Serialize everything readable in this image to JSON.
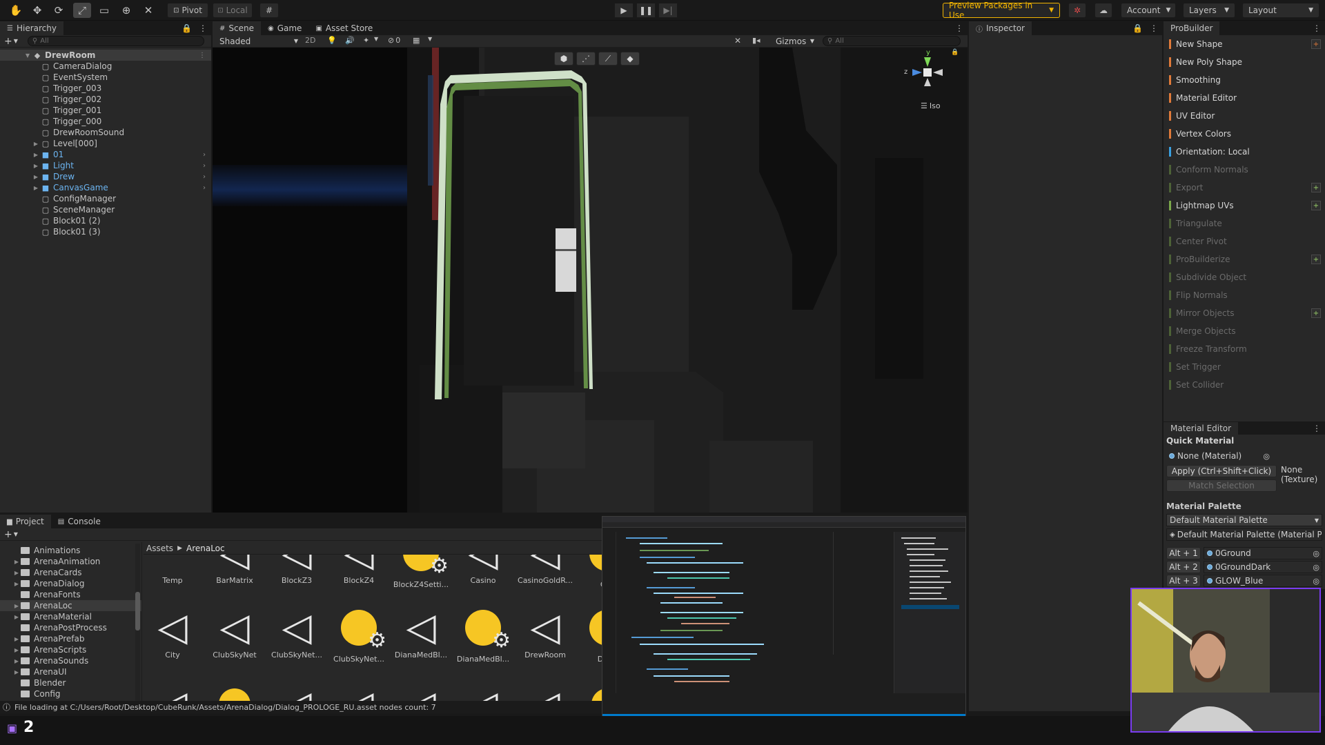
{
  "toolbar": {
    "pivot_label": "Pivot",
    "local_label": "Local",
    "preview_label": "Preview Packages in Use",
    "account_label": "Account",
    "layers_label": "Layers",
    "layout_label": "Layout"
  },
  "hierarchy": {
    "tab_label": "Hierarchy",
    "search_placeholder": "All",
    "root": "DrewRoom",
    "items": [
      {
        "label": "CameraDialog",
        "prefab": false,
        "expand": false
      },
      {
        "label": "EventSystem",
        "prefab": false,
        "expand": false
      },
      {
        "label": "Trigger_003",
        "prefab": false,
        "expand": false
      },
      {
        "label": "Trigger_002",
        "prefab": false,
        "expand": false
      },
      {
        "label": "Trigger_001",
        "prefab": false,
        "expand": false
      },
      {
        "label": "Trigger_000",
        "prefab": false,
        "expand": false
      },
      {
        "label": "DrewRoomSound",
        "prefab": false,
        "expand": false
      },
      {
        "label": "Level[000]",
        "prefab": false,
        "expand": true
      },
      {
        "label": "01",
        "prefab": true,
        "expand": true
      },
      {
        "label": "Light",
        "prefab": true,
        "expand": true
      },
      {
        "label": "Drew",
        "prefab": true,
        "expand": true
      },
      {
        "label": "CanvasGame",
        "prefab": true,
        "expand": true
      },
      {
        "label": "ConfigManager",
        "prefab": false,
        "expand": false
      },
      {
        "label": "SceneManager",
        "prefab": false,
        "expand": false
      },
      {
        "label": "Block01 (2)",
        "prefab": false,
        "expand": false
      },
      {
        "label": "Block01 (3)",
        "prefab": false,
        "expand": false
      }
    ]
  },
  "scene": {
    "tabs": {
      "scene": "Scene",
      "game": "Game",
      "asset_store": "Asset Store"
    },
    "shading": "Shaded",
    "mode_2d": "2D",
    "hidden_count": "0",
    "gizmos": "Gizmos",
    "search_placeholder": "All",
    "iso_label": "Iso",
    "axis_y": "y",
    "axis_z": "z"
  },
  "inspector": {
    "tab_label": "Inspector"
  },
  "probuilder": {
    "tab_label": "ProBuilder",
    "items": [
      {
        "label": "New Shape",
        "enabled": true,
        "color": "#e07a3a",
        "plus": true
      },
      {
        "label": "New Poly Shape",
        "enabled": true,
        "color": "#e07a3a",
        "plus": false
      },
      {
        "label": "Smoothing",
        "enabled": true,
        "color": "#e07a3a",
        "plus": false
      },
      {
        "label": "Material Editor",
        "enabled": true,
        "color": "#e07a3a",
        "plus": false
      },
      {
        "label": "UV Editor",
        "enabled": true,
        "color": "#e07a3a",
        "plus": false
      },
      {
        "label": "Vertex Colors",
        "enabled": true,
        "color": "#e07a3a",
        "plus": false
      },
      {
        "label": "Orientation: Local",
        "enabled": true,
        "color": "#3aa0e0",
        "plus": false
      },
      {
        "label": "Conform Normals",
        "enabled": false,
        "color": "#7aa84a",
        "plus": false
      },
      {
        "label": "Export",
        "enabled": false,
        "color": "#7aa84a",
        "plus": true
      },
      {
        "label": "Lightmap UVs",
        "enabled": true,
        "color": "#7aa84a",
        "plus": true
      },
      {
        "label": "Triangulate",
        "enabled": false,
        "color": "#7aa84a",
        "plus": false
      },
      {
        "label": "Center Pivot",
        "enabled": false,
        "color": "#7aa84a",
        "plus": false
      },
      {
        "label": "ProBuilderize",
        "enabled": false,
        "color": "#7aa84a",
        "plus": true
      },
      {
        "label": "Subdivide Object",
        "enabled": false,
        "color": "#7aa84a",
        "plus": false
      },
      {
        "label": "Flip Normals",
        "enabled": false,
        "color": "#7aa84a",
        "plus": false
      },
      {
        "label": "Mirror Objects",
        "enabled": false,
        "color": "#7aa84a",
        "plus": true
      },
      {
        "label": "Merge Objects",
        "enabled": false,
        "color": "#7aa84a",
        "plus": false
      },
      {
        "label": "Freeze Transform",
        "enabled": false,
        "color": "#7aa84a",
        "plus": false
      },
      {
        "label": "Set Trigger",
        "enabled": false,
        "color": "#7aa84a",
        "plus": false
      },
      {
        "label": "Set Collider",
        "enabled": false,
        "color": "#7aa84a",
        "plus": false
      }
    ]
  },
  "material_editor": {
    "tab_label": "Material Editor",
    "quick_material": "Quick Material",
    "none_material": "None (Material)",
    "apply_label": "Apply (Ctrl+Shift+Click)",
    "match_label": "Match Selection",
    "texture_line1": "None",
    "texture_line2": "(Texture)",
    "palette_heading": "Material Palette",
    "palette_select": "Default Material Palette",
    "palette_object": "Default Material Palette (Material P",
    "slots": [
      {
        "key": "Alt + 1",
        "name": "0Ground"
      },
      {
        "key": "Alt + 2",
        "name": "0GroundDark"
      },
      {
        "key": "Alt + 3",
        "name": "GLOW_Blue"
      }
    ]
  },
  "project": {
    "tabs": {
      "project": "Project",
      "console": "Console"
    },
    "breadcrumb": {
      "root": "Assets",
      "current": "ArenaLoc"
    },
    "folders": [
      {
        "label": "Animations",
        "expand": false
      },
      {
        "label": "ArenaAnimation",
        "expand": true
      },
      {
        "label": "ArenaCards",
        "expand": true
      },
      {
        "label": "ArenaDialog",
        "expand": true
      },
      {
        "label": "ArenaFonts",
        "expand": false
      },
      {
        "label": "ArenaLoc",
        "expand": true
      },
      {
        "label": "ArenaMaterial",
        "expand": true
      },
      {
        "label": "ArenaPostProcess",
        "expand": false
      },
      {
        "label": "ArenaPrefab",
        "expand": true
      },
      {
        "label": "ArenaScripts",
        "expand": true
      },
      {
        "label": "ArenaSounds",
        "expand": true
      },
      {
        "label": "ArenaUI",
        "expand": true
      },
      {
        "label": "Blender",
        "expand": false
      },
      {
        "label": "Config",
        "expand": false
      }
    ],
    "assets_row1": [
      {
        "label": "Temp",
        "kind": "folder"
      },
      {
        "label": "BarMatrix",
        "kind": "unity"
      },
      {
        "label": "BlockZ3",
        "kind": "unity"
      },
      {
        "label": "BlockZ4",
        "kind": "unity"
      },
      {
        "label": "BlockZ4Setti...",
        "kind": "settings"
      },
      {
        "label": "Casino",
        "kind": "unity"
      },
      {
        "label": "CasinoGoldR...",
        "kind": "unity"
      },
      {
        "label": "Cas",
        "kind": "settings"
      }
    ],
    "assets_row2": [
      {
        "label": "City",
        "kind": "unity"
      },
      {
        "label": "ClubSkyNet",
        "kind": "unity"
      },
      {
        "label": "ClubSkyNet...",
        "kind": "unity"
      },
      {
        "label": "ClubSkyNet...",
        "kind": "settings"
      },
      {
        "label": "DianaMedBl...",
        "kind": "unity"
      },
      {
        "label": "DianaMedBl...",
        "kind": "settings"
      },
      {
        "label": "DrewRoom",
        "kind": "unity"
      },
      {
        "label": "Drew",
        "kind": "settings"
      }
    ]
  },
  "status": {
    "text": "File loading at C:/Users/Root/Desktop/CubeRunk/Assets/ArenaDialog/Dialog_PROLOGE_RU.asset nodes count: 7"
  },
  "overlay": {
    "stream_digit": "2"
  }
}
